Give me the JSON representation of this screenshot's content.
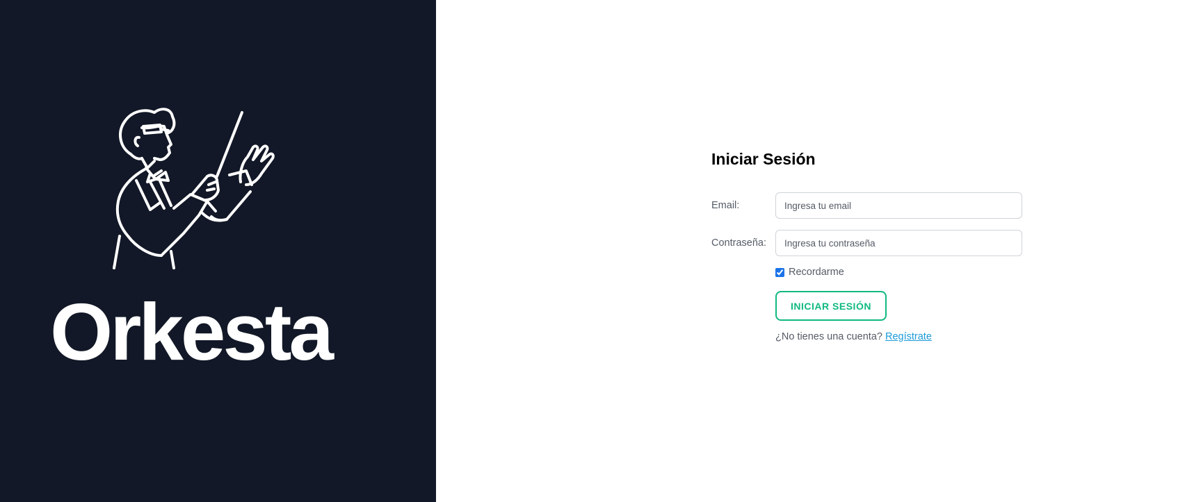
{
  "brand": {
    "name": "Orkesta",
    "logo_icon": "conductor-illustration",
    "panel_color": "#121827"
  },
  "login": {
    "title": "Iniciar Sesión",
    "email_label": "Email:",
    "email_placeholder": "Ingresa tu email",
    "email_value": "",
    "password_label": "Contraseña:",
    "password_placeholder": "Ingresa tu contraseña",
    "password_value": "",
    "remember_label": "Recordarme",
    "remember_checked": true,
    "submit_label": "INICIAR SESIÓN",
    "register_prompt": "¿No tienes una cuenta?",
    "register_link": "Regístrate",
    "accent_color": "#10b981",
    "link_color": "#1a9ad8"
  }
}
